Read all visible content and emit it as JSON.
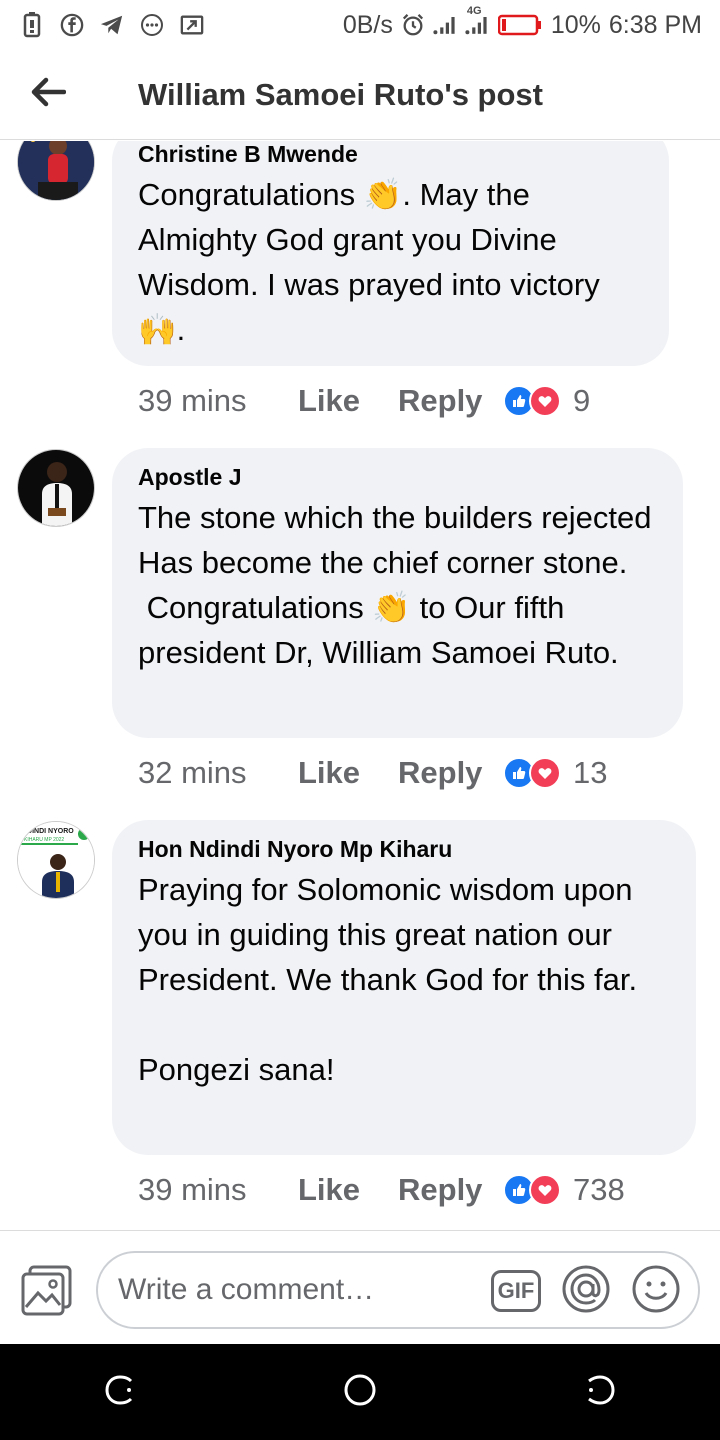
{
  "status_bar": {
    "net_speed": "0B/s",
    "network_label": "4G",
    "battery": "10%",
    "time": "6:38 PM",
    "icons": [
      "battery-saver-icon",
      "facebook-icon",
      "telegram-icon",
      "chat-icon",
      "cast-icon",
      "alarm-icon",
      "signal-icon",
      "signal-4g-icon",
      "battery-icon"
    ]
  },
  "app_bar": {
    "title": "William Samoei Ruto's post",
    "back_icon": "arrow-left-icon"
  },
  "comments": [
    {
      "author": "Christine B Mwende",
      "text_parts": [
        "Congratulations ",
        "clap",
        ". May the Almighty God grant you Divine Wisdom. I was prayed into victory ",
        "raised-hands",
        "."
      ],
      "time": "39 mins",
      "like_label": "Like",
      "reply_label": "Reply",
      "reaction_count": "9"
    },
    {
      "author": "Apostle J",
      "text_parts": [
        "The stone which the builders rejected Has become the chief corner stone.\n Congratulations ",
        "clap",
        " to Our fifth president Dr, William Samoei Ruto."
      ],
      "time": "32 mins",
      "like_label": "Like",
      "reply_label": "Reply",
      "reaction_count": "13"
    },
    {
      "author": "Hon Ndindi Nyoro Mp Kiharu",
      "text_parts": [
        "Praying for Solomonic wisdom upon you in guiding this great nation our President. We thank God for this far.\n\nPongezi sana!"
      ],
      "time": "39 mins",
      "like_label": "Like",
      "reply_label": "Reply",
      "reaction_count": "738",
      "avatar_text": [
        "NDINDI NYORO",
        "KIHARU MP 2022"
      ]
    }
  ],
  "composer": {
    "placeholder": "Write a comment…",
    "gif_label": "GIF",
    "icons": [
      "photo-icon",
      "gif-icon",
      "mention-icon",
      "emoji-icon"
    ]
  },
  "colors": {
    "like_blue": "#1877f2",
    "love_red": "#f33e58",
    "bubble_bg": "#f0f2f5",
    "meta_gray": "#65676b"
  }
}
